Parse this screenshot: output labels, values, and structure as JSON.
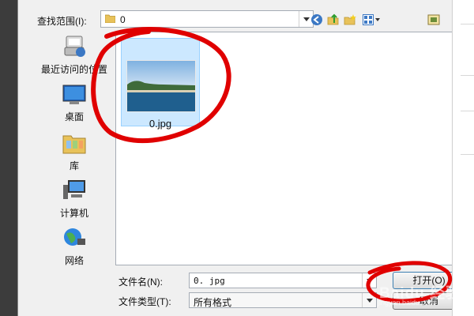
{
  "toolbar": {
    "look_in_label": "查找范围(I):",
    "current_folder": "0"
  },
  "places": [
    {
      "label": "最近访问的位置",
      "icon": "recent-places-icon"
    },
    {
      "label": "桌面",
      "icon": "desktop-icon"
    },
    {
      "label": "库",
      "icon": "libraries-icon"
    },
    {
      "label": "计算机",
      "icon": "computer-icon"
    },
    {
      "label": "网络",
      "icon": "network-icon"
    }
  ],
  "files": [
    {
      "name": "0.jpg",
      "selected": true
    }
  ],
  "file_name": {
    "label": "文件名(N):",
    "value": "0. jpg"
  },
  "file_type": {
    "label": "文件类型(T):",
    "value": "所有格式"
  },
  "buttons": {
    "open": "打开(O)",
    "cancel": "取消"
  },
  "watermark": {
    "brand": "Baidu 经验",
    "url": "jingyan.baidu.com"
  },
  "colors": {
    "selection": "#cce8ff",
    "annotation": "#e00000"
  }
}
